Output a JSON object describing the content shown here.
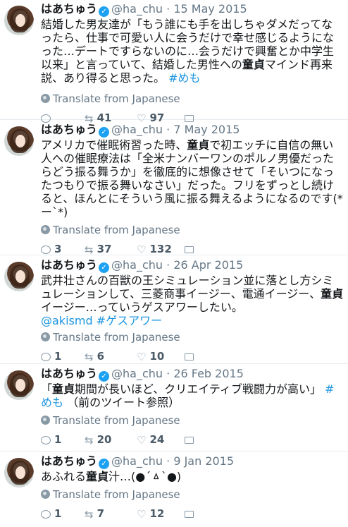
{
  "tweets": [
    {
      "name": "はあちゅう",
      "handle": "@ha_chu",
      "date": "15 May 2015",
      "text_parts": [
        "結婚した男友達が「もう誰にも手を出しちゃダメだってなったら、仕事で可愛い人に会うだけで幸せ感じるようになった…デートですらないのに…会うだけで興奮とか中学生以来」と言っていて、結婚した男性への",
        "童貞",
        "マインド再来説、あり得ると思った。 ",
        "#めも"
      ],
      "translate": "Translate from Japanese",
      "reply_count": "",
      "retweet_count": "41",
      "like_count": "97"
    },
    {
      "name": "はあちゅう",
      "handle": "@ha_chu",
      "date": "7 May 2015",
      "text_parts": [
        "アメリカで催眠術習った時、",
        "童貞",
        "で初エッチに自信の無い人への催眠療法は「全米ナンバーワンのポルノ男優だったらどう振る舞うか」を徹底的に想像させて「そいつになったつもりで振る舞いなさい」だった。フリをずっとし続けると、ほんとにそういう風に振る舞えるようになるのです(*ー`*)"
      ],
      "translate": "Translate from Japanese",
      "reply_count": "3",
      "retweet_count": "37",
      "like_count": "132"
    },
    {
      "name": "はあちゅう",
      "handle": "@ha_chu",
      "date": "26 Apr 2015",
      "text_parts": [
        "武井壮さんの百獣の王シミュレーション並に落とし方シミュレーションして、三菱商事イージー、電通イージー、",
        "童貞",
        "イージー…っていうゲスアワーしたい。",
        "@akismd #ゲスアワー"
      ],
      "translate": "Translate from Japanese",
      "reply_count": "1",
      "retweet_count": "6",
      "like_count": "10"
    },
    {
      "name": "はあちゅう",
      "handle": "@ha_chu",
      "date": "26 Feb 2015",
      "text_parts": [
        "「",
        "童貞",
        "期間が長いほど、クリエイティブ戦闘力が高い」 ",
        "#めも",
        " （前のツイート参照）"
      ],
      "translate": "Translate from Japanese",
      "reply_count": "1",
      "retweet_count": "20",
      "like_count": "24"
    },
    {
      "name": "はあちゅう",
      "handle": "@ha_chu",
      "date": "9 Jan 2015",
      "text_parts": [
        "あふれる",
        "童貞",
        "汁…(●´ㅿ`●)"
      ],
      "translate": "Translate from Japanese",
      "reply_count": "1",
      "retweet_count": "7",
      "like_count": "12"
    }
  ],
  "icons": [
    "verified-icon",
    "globe-icon",
    "reply-icon",
    "retweet-icon",
    "like-icon",
    "message-icon"
  ],
  "colors": {
    "link": "#1b95e0",
    "verified": "#1da1f2",
    "meta": "#657786"
  }
}
